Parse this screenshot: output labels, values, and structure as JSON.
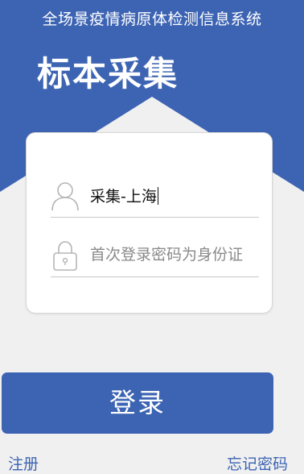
{
  "colors": {
    "primary": "#3d64b3",
    "background": "#f0f0f0",
    "card": "#ffffff",
    "underline": "#c7c7c7",
    "placeholder": "#8a8a8a"
  },
  "header": {
    "app_title": "全场景疫情病原体检测信息系统",
    "page_title": "标本采集"
  },
  "form": {
    "username": {
      "icon": "user-icon",
      "value": "采集-上海"
    },
    "password": {
      "icon": "lock-icon",
      "placeholder": "首次登录密码为身份证"
    }
  },
  "actions": {
    "login_label": "登录",
    "register_label": "注册",
    "forgot_label": "忘记密码"
  }
}
